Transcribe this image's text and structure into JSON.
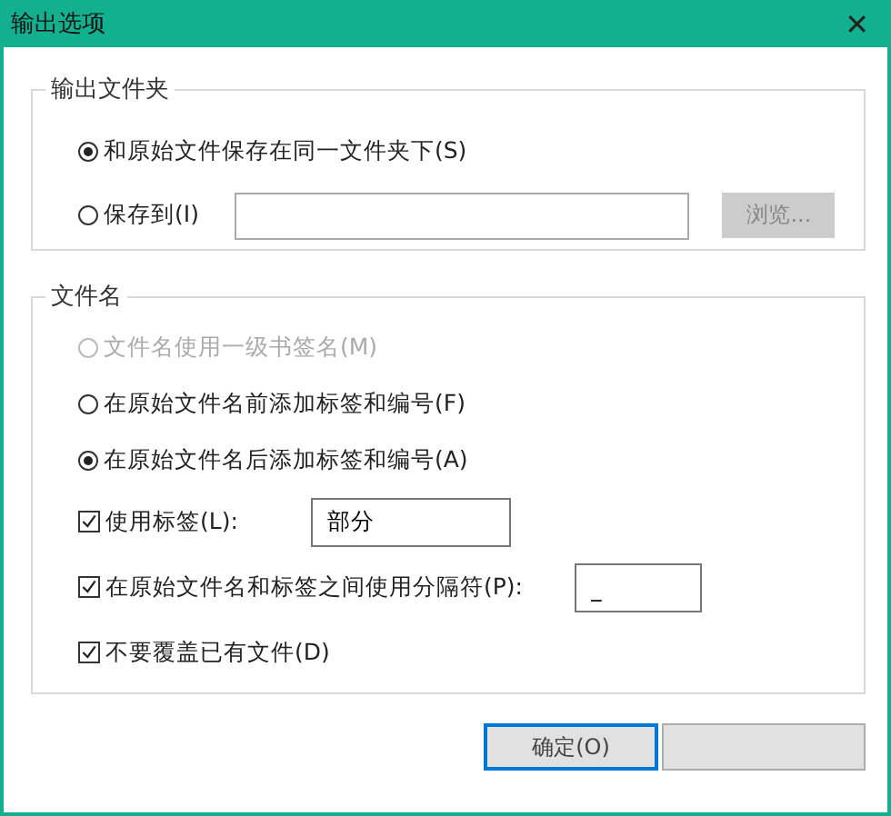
{
  "window": {
    "title": "输出选项",
    "close": "✕"
  },
  "output_folder": {
    "legend": "输出文件夹",
    "options": [
      {
        "label": "和原始文件保存在同一文件夹下(S)",
        "selected": true
      },
      {
        "label": "保存到(I)",
        "selected": false
      }
    ],
    "browse": {
      "label": "浏览...",
      "disabled": true
    }
  },
  "file_name": {
    "legend": "文件名",
    "options": [
      {
        "label": "文件名使用一级书签名(M)",
        "selected": false,
        "disabled": true
      },
      {
        "label": "在原始文件名前添加标签和编号(F)",
        "selected": false,
        "disabled": false
      },
      {
        "label": "在原始文件名后添加标签和编号(A)",
        "selected": true,
        "disabled": false
      }
    ],
    "checks": [
      {
        "label": "使用标签(L):",
        "checked": true,
        "value": "部分",
        "kind": "label"
      },
      {
        "label": "在原始文件名和标签之间使用分隔符(P):",
        "checked": true,
        "value": "_",
        "kind": "separator"
      },
      {
        "label": "不要覆盖已有文件(D)",
        "checked": true,
        "kind": "plain"
      }
    ]
  },
  "buttons": [
    {
      "label": "确定(O)",
      "default": true
    },
    {
      "default": false
    }
  ]
}
